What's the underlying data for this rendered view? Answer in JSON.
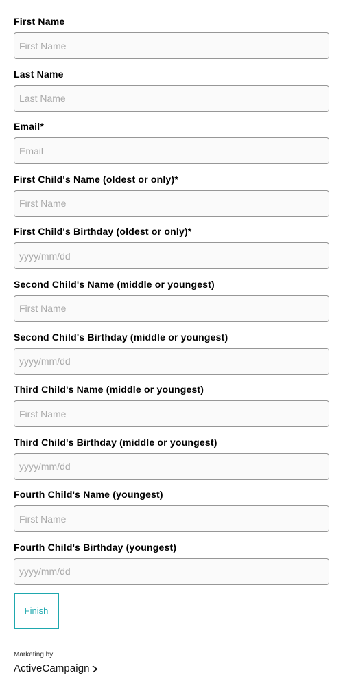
{
  "form": {
    "fields": [
      {
        "label": "First Name",
        "placeholder": "First Name"
      },
      {
        "label": "Last Name",
        "placeholder": "Last Name"
      },
      {
        "label": "Email*",
        "placeholder": "Email"
      },
      {
        "label": "First Child's Name (oldest or only)*",
        "placeholder": "First Name"
      },
      {
        "label": "First Child's Birthday (oldest or only)*",
        "placeholder": "yyyy/mm/dd"
      },
      {
        "label": "Second Child's Name (middle or youngest)",
        "placeholder": "First Name"
      },
      {
        "label": "Second Child's Birthday (middle or youngest)",
        "placeholder": "yyyy/mm/dd"
      },
      {
        "label": "Third Child's Name (middle or youngest)",
        "placeholder": "First Name"
      },
      {
        "label": "Third Child's Birthday (middle or youngest)",
        "placeholder": "yyyy/mm/dd"
      },
      {
        "label": "Fourth Child's Name (youngest)",
        "placeholder": "First Name"
      },
      {
        "label": "Fourth Child's Birthday (youngest)",
        "placeholder": "yyyy/mm/dd"
      }
    ],
    "submit_label": "Finish"
  },
  "branding": {
    "marketing_by": "Marketing by",
    "name": "ActiveCampaign",
    "icon": "chevron-right-icon"
  },
  "colors": {
    "accent": "#1fa8ae",
    "input_border": "#979797",
    "input_background": "#fafafa",
    "placeholder": "#aaaaaa"
  }
}
